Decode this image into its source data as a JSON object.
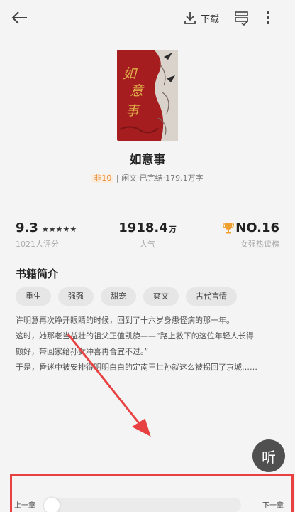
{
  "header": {
    "download_label": "下载"
  },
  "book": {
    "title": "如意事",
    "cover_text": "如意事",
    "badge": "非10",
    "meta": " | 闲文·已完结·179.1万字"
  },
  "stats": {
    "rating_value": "9.3",
    "rating_stars": "★★★★★",
    "rating_sub": "1021人评分",
    "popularity_value": "1918.4",
    "popularity_unit": "万",
    "popularity_sub": "人气",
    "rank_value": "NO.16",
    "rank_sub": "女强热读榜"
  },
  "synopsis": {
    "section_title": "书籍简介",
    "tags": [
      "重生",
      "强强",
      "甜宠",
      "爽文",
      "古代言情"
    ],
    "lines": [
      "许明意再次睁开眼睛的时候，回到了十六岁身患怪病的那一年。",
      "这时，她那老当益壮的祖父正值凯旋——“路上救下的这位年轻人长得",
      "颇好，带回家给孙女冲喜再合宜不过。”",
      "于是，昏迷中被安排得明明白白的定南王世孙就这么被拐回了京城……"
    ]
  },
  "listen_label": "听",
  "chapter_nav": {
    "prev": "上一章",
    "next": "下一章"
  },
  "colors": {
    "annotation_red": "#e84142",
    "cover_red": "#a51d1f",
    "cover_gold": "#e0b24a"
  }
}
